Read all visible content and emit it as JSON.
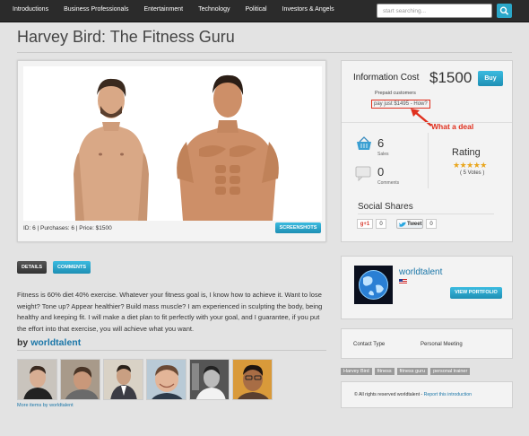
{
  "nav": {
    "items": [
      "Introductions",
      "Business Professionals",
      "Entertainment",
      "Technology",
      "Political",
      "Investors & Angels"
    ],
    "search_placeholder": "start searching..."
  },
  "page_title": "Harvey Bird: The Fitness Guru",
  "item": {
    "meta": "ID: 6 | Purchases: 6 | Price: $1500",
    "screenshots_label": "SCREENSHOTS"
  },
  "info": {
    "cost_label": "Information Cost",
    "price": "$1500",
    "buy_label": "Buy",
    "prepaid": "Prepaid customers",
    "pay_link": "pay just $1495 - How?",
    "annotation": "What a deal",
    "sales_count": "6",
    "sales_label": "Sales",
    "comments_count": "0",
    "comments_label": "Comments",
    "rating_label": "Rating",
    "rating_stars": 5,
    "votes": "( 5 Votes )",
    "social_title": "Social Shares",
    "gplus_label": "g+1",
    "gplus_count": "0",
    "tweet_label": "Tweet",
    "tweet_count": "0"
  },
  "tabs": {
    "details": "DETAILS",
    "comments": "COMMENTS"
  },
  "description": "Fitness is 60% diet 40% exercise. Whatever your fitness goal is, I know how to achieve it. Want to lose weight? Tone up? Appear healthier? Build mass muscle? I am experienced in sculpting the body, being healthy and keeping fit. I will make a diet plan to fit perfectly with your goal, and I guarantee, if you put the effort into that exercise, you will achieve what you want.",
  "by": {
    "prefix": "by",
    "author": "worldtalent",
    "more_label": "More items by worldtalent"
  },
  "author_card": {
    "name": "worldtalent",
    "portfolio_label": "VIEW PORTFOLIO"
  },
  "contact": {
    "label": "Contact Type",
    "value": "Personal Meeting"
  },
  "tags": [
    "Harvey Bird",
    "fitness",
    "fitness guru",
    "personal trainer"
  ],
  "footer": {
    "copyright": "© All rights reserved worldtalent - ",
    "report_link": "Report this introduction"
  },
  "colors": {
    "accent": "#2aa7c9",
    "annotation": "#e0301e",
    "link": "#1a76a8",
    "star": "#e9a61d"
  }
}
